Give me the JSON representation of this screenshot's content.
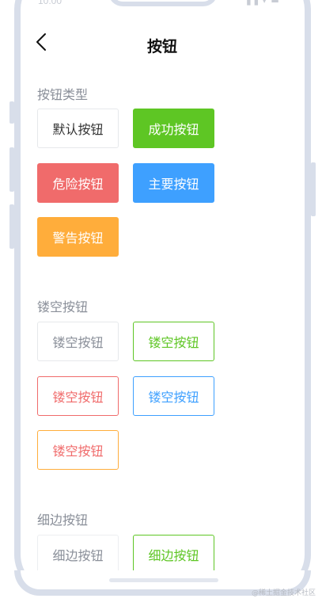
{
  "status": {
    "time": "10:00",
    "icons": "▐▐ ▾ ▬"
  },
  "nav": {
    "title": "按钮"
  },
  "sections": {
    "type": {
      "title": "按钮类型",
      "buttons": [
        "默认按钮",
        "成功按钮",
        "危险按钮",
        "主要按钮",
        "警告按钮"
      ]
    },
    "plain": {
      "title": "镂空按钮",
      "buttons": [
        "镂空按钮",
        "镂空按钮",
        "镂空按钮",
        "镂空按钮",
        "镂空按钮"
      ]
    },
    "thin": {
      "title": "细边按钮",
      "buttons": [
        "细边按钮",
        "细边按钮"
      ]
    }
  },
  "colors": {
    "success": "#5ec624",
    "danger": "#f06b6b",
    "primary": "#3ea0ff",
    "warning": "#ffad3b",
    "frame": "#d8deea"
  },
  "watermark": "@稀土掘金技术社区"
}
